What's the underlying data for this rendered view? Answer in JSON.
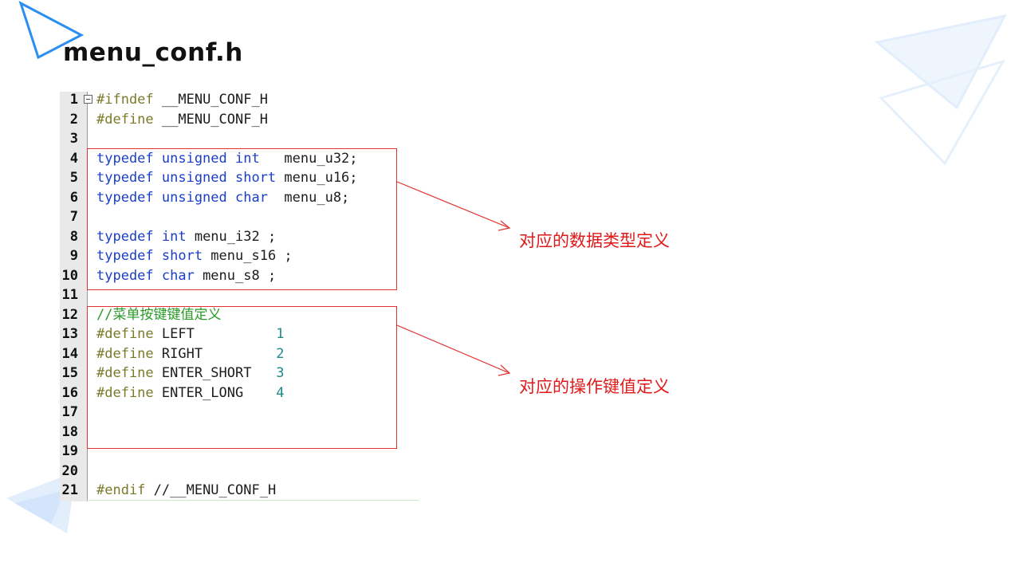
{
  "slide": {
    "title": "menu_conf.h",
    "annotations": [
      "对应的数据类型定义",
      "对应的操作键值定义"
    ]
  },
  "editor": {
    "lines": [
      {
        "n": "1",
        "tokens": [
          {
            "t": "#ifndef",
            "c": "pp"
          },
          {
            "t": " __MENU_CONF_H",
            "c": ""
          }
        ]
      },
      {
        "n": "2",
        "tokens": [
          {
            "t": "#define",
            "c": "pp"
          },
          {
            "t": " __MENU_CONF_H",
            "c": ""
          }
        ]
      },
      {
        "n": "3",
        "tokens": []
      },
      {
        "n": "4",
        "tokens": [
          {
            "t": "typedef unsigned int",
            "c": "kw"
          },
          {
            "t": "   menu_u32;",
            "c": ""
          }
        ]
      },
      {
        "n": "5",
        "tokens": [
          {
            "t": "typedef unsigned short",
            "c": "kw"
          },
          {
            "t": " menu_u16;",
            "c": ""
          }
        ]
      },
      {
        "n": "6",
        "tokens": [
          {
            "t": "typedef unsigned char",
            "c": "kw"
          },
          {
            "t": "  menu_u8;",
            "c": ""
          }
        ]
      },
      {
        "n": "7",
        "tokens": []
      },
      {
        "n": "8",
        "tokens": [
          {
            "t": "typedef int",
            "c": "kw"
          },
          {
            "t": " menu_i32 ;",
            "c": ""
          }
        ]
      },
      {
        "n": "9",
        "tokens": [
          {
            "t": "typedef short",
            "c": "kw"
          },
          {
            "t": " menu_s16 ;",
            "c": ""
          }
        ]
      },
      {
        "n": "10",
        "tokens": [
          {
            "t": "typedef char",
            "c": "kw"
          },
          {
            "t": " menu_s8 ;",
            "c": ""
          }
        ]
      },
      {
        "n": "11",
        "tokens": []
      },
      {
        "n": "12",
        "tokens": [
          {
            "t": "//菜单按键键值定义",
            "c": "cm"
          }
        ]
      },
      {
        "n": "13",
        "tokens": [
          {
            "t": "#define",
            "c": "pp"
          },
          {
            "t": " LEFT          ",
            "c": ""
          },
          {
            "t": "1",
            "c": "num"
          }
        ]
      },
      {
        "n": "14",
        "tokens": [
          {
            "t": "#define",
            "c": "pp"
          },
          {
            "t": " RIGHT         ",
            "c": ""
          },
          {
            "t": "2",
            "c": "num"
          }
        ]
      },
      {
        "n": "15",
        "tokens": [
          {
            "t": "#define",
            "c": "pp"
          },
          {
            "t": " ENTER_SHORT   ",
            "c": ""
          },
          {
            "t": "3",
            "c": "num"
          }
        ]
      },
      {
        "n": "16",
        "tokens": [
          {
            "t": "#define",
            "c": "pp"
          },
          {
            "t": " ENTER_LONG    ",
            "c": ""
          },
          {
            "t": "4",
            "c": "num"
          }
        ]
      },
      {
        "n": "17",
        "tokens": []
      },
      {
        "n": "18",
        "tokens": []
      },
      {
        "n": "19",
        "tokens": []
      },
      {
        "n": "20",
        "tokens": []
      },
      {
        "n": "21",
        "tokens": [
          {
            "t": "#endif",
            "c": "pp"
          },
          {
            "t": " //__MENU_CONF_H",
            "c": ""
          }
        ]
      }
    ]
  },
  "colors": {
    "annotation_red": "#e01a1a",
    "keyword_blue": "#1a3ec9",
    "preprocessor": "#7a7a2a",
    "number_teal": "#1f8a8a",
    "comment_green": "#2a9a2a",
    "decor_blue": "#2b8ff0"
  },
  "icons": {
    "top_left": "triangle-outline-icon",
    "top_right": "triangles-decor-icon",
    "bottom_left": "triangles-decor-icon"
  }
}
